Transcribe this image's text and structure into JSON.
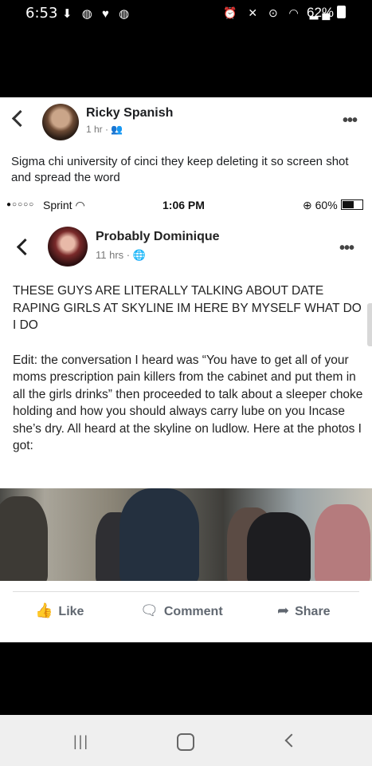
{
  "status_bar": {
    "time": "6:53",
    "left_icons": "⬇ ◍ ♥ ◍",
    "right_icons": "⏰ ✕ ⊙ ◠ ▂▄",
    "battery": "62%"
  },
  "post": {
    "author": "Ricky Spanish",
    "meta": "1 hr · 👥",
    "caption": "Sigma chi university of cinci they keep deleting it so screen shot and spread the word"
  },
  "embedded": {
    "status": {
      "signal_dots": "●○○○○",
      "carrier": "Sprint ◠",
      "time": "1:06 PM",
      "battery": "⊕ 60%"
    },
    "author": "Probably Dominique",
    "meta": "11 hrs · 🌐",
    "text_1": "THESE GUYS ARE LITERALLY TALKING ABOUT DATE RAPING GIRLS AT SKYLINE IM HERE BY MYSELF WHAT DO I DO",
    "text_2": "Edit: the conversation I heard was “You have to get all of your moms prescription pain killers from the cabinet and put them in all the girls drinks” then proceeded to talk about a sleeper choke holding and how you should always carry lube on you Incase she’s dry. All heard at the skyline on ludlow. Here at the photos I got:"
  },
  "actions": {
    "like": "Like",
    "comment": "Comment",
    "share": "Share"
  },
  "icons": {
    "like": "👍",
    "comment": "🗨",
    "share": "➦"
  },
  "nav": {
    "recents": "|||"
  }
}
